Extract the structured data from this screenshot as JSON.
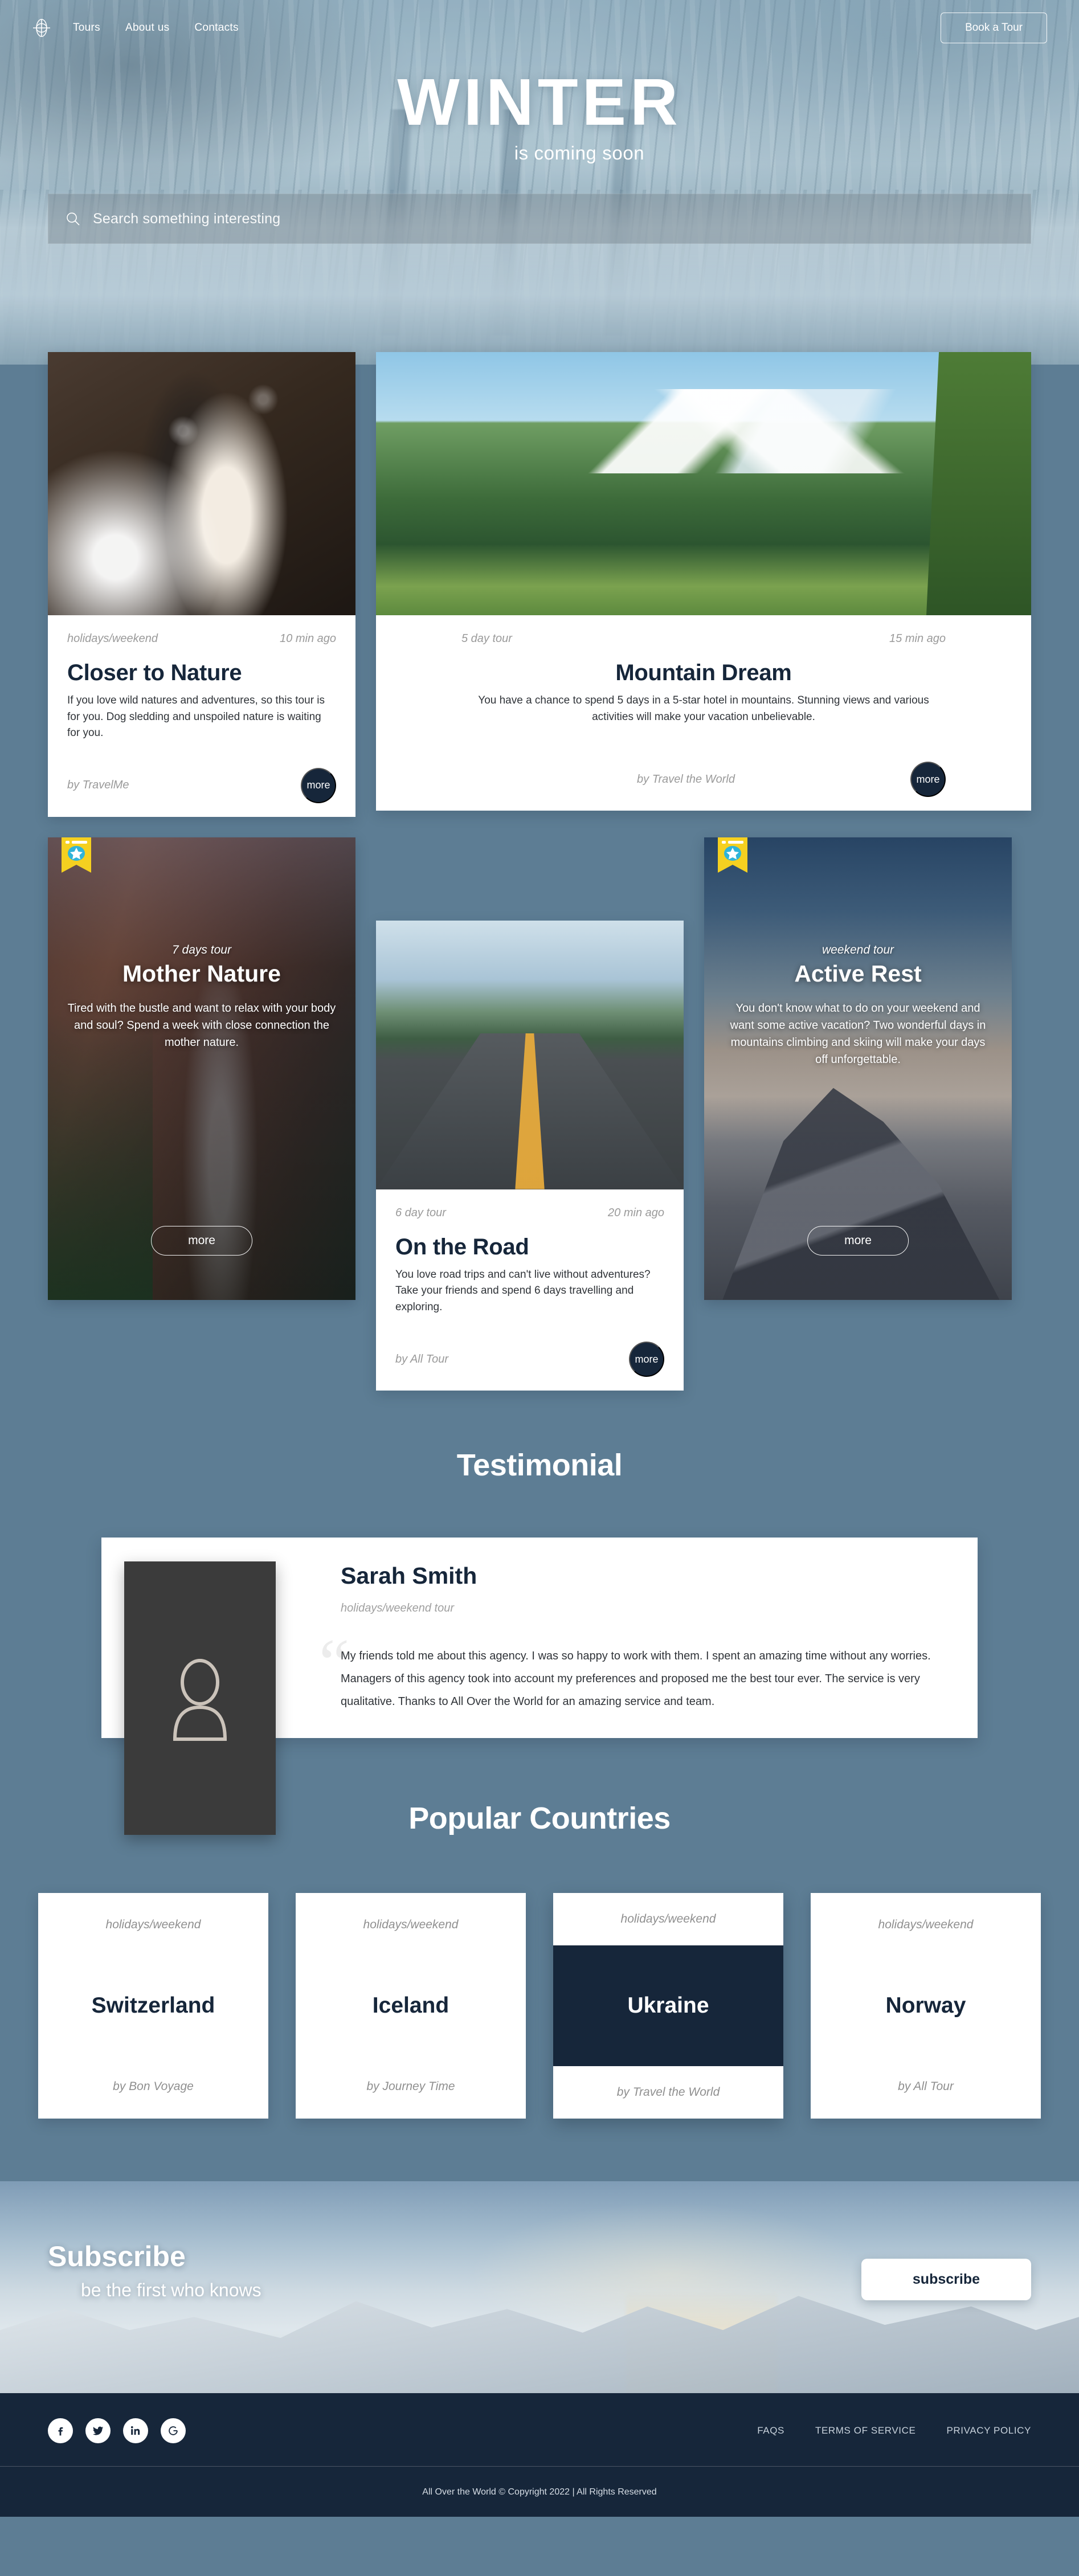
{
  "nav": {
    "logo_icon": "globe-icon",
    "links": [
      {
        "label": "Tours"
      },
      {
        "label": "About us"
      },
      {
        "label": "Contacts"
      }
    ],
    "cta_label": "Book a Tour"
  },
  "hero": {
    "title": "WINTER",
    "subtitle": "is coming soon",
    "search": {
      "icon": "search-icon",
      "placeholder": "Search something interesting",
      "value": ""
    }
  },
  "tours": {
    "closer_to_nature": {
      "tag": "holidays/weekend",
      "time": "10 min ago",
      "title": "Closer to Nature",
      "desc": "If you love wild natures and adventures, so this tour is for you. Dog sledding and unspoiled nature is waiting for you.",
      "by": "by TravelMe",
      "more_label": "more"
    },
    "mountain_dream": {
      "tag": "5 day tour",
      "time": "15 min ago",
      "title": "Mountain Dream",
      "desc": "You have a chance to spend 5 days in a 5-star hotel in mountains. Stunning views and various activities will make your vacation unbelievable.",
      "by": "by Travel the World",
      "more_label": "more"
    },
    "mother_nature": {
      "tag": "7 days tour",
      "title": "Mother Nature",
      "desc": "Tired with the bustle and want to relax with your body and soul? Spend a week with close connection the mother nature.",
      "more_label": "more",
      "badge_icon": "star-ribbon-icon"
    },
    "on_the_road": {
      "tag": "6 day tour",
      "time": "20 min ago",
      "title": "On the Road",
      "desc": "You love road trips and can't live without adventures? Take your friends and spend 6 days travelling and exploring.",
      "by": "by All Tour",
      "more_label": "more"
    },
    "active_rest": {
      "tag": "weekend tour",
      "title": "Active Rest",
      "desc": "You don't know what to do on your weekend and want some active vacation? Two wonderful days in mountains climbing and skiing will make your days off unforgettable.",
      "more_label": "more",
      "badge_icon": "star-ribbon-icon"
    }
  },
  "testimonial": {
    "section_title": "Testimonial",
    "avatar_icon": "person-icon",
    "name": "Sarah Smith",
    "tag": "holidays/weekend tour",
    "quote_mark": "“",
    "text": "My friends told me about this agency. I was so happy to work with them. I spent an amazing time without any worries. Managers of this agency took into account my preferences and proposed me the best tour ever. The service is very qualitative. Thanks to All Over the World for an amazing service and team."
  },
  "countries": {
    "section_title": "Popular Countries",
    "items": [
      {
        "tag": "holidays/weekend",
        "name": "Switzerland",
        "by": "by Bon Voyage",
        "active": false
      },
      {
        "tag": "holidays/weekend",
        "name": "Iceland",
        "by": "by Journey Time",
        "active": false
      },
      {
        "tag": "holidays/weekend",
        "name": "Ukraine",
        "by": "by Travel the World",
        "active": true
      },
      {
        "tag": "holidays/weekend",
        "name": "Norway",
        "by": "by All Tour",
        "active": false
      }
    ]
  },
  "subscribe": {
    "title": "Subscribe",
    "subtitle": "be the first who knows",
    "button_label": "subscribe"
  },
  "footer": {
    "social": [
      {
        "name": "facebook-icon",
        "glyph": "f"
      },
      {
        "name": "twitter-icon",
        "glyph": "t"
      },
      {
        "name": "linkedin-icon",
        "glyph": "in"
      },
      {
        "name": "google-icon",
        "glyph": "G"
      }
    ],
    "links": [
      {
        "label": "FAQS"
      },
      {
        "label": "TERMS OF SERVICE"
      },
      {
        "label": "PRIVACY POLICY"
      }
    ],
    "copyright": "All Over the World © Copyright 2022 | All Rights Reserved"
  },
  "colors": {
    "page_bg": "#5d7d94",
    "dark": "#16263a",
    "ribbon_yellow": "#f5d020",
    "ribbon_blue": "#2fb4d9",
    "accent_white": "#ffffff"
  }
}
